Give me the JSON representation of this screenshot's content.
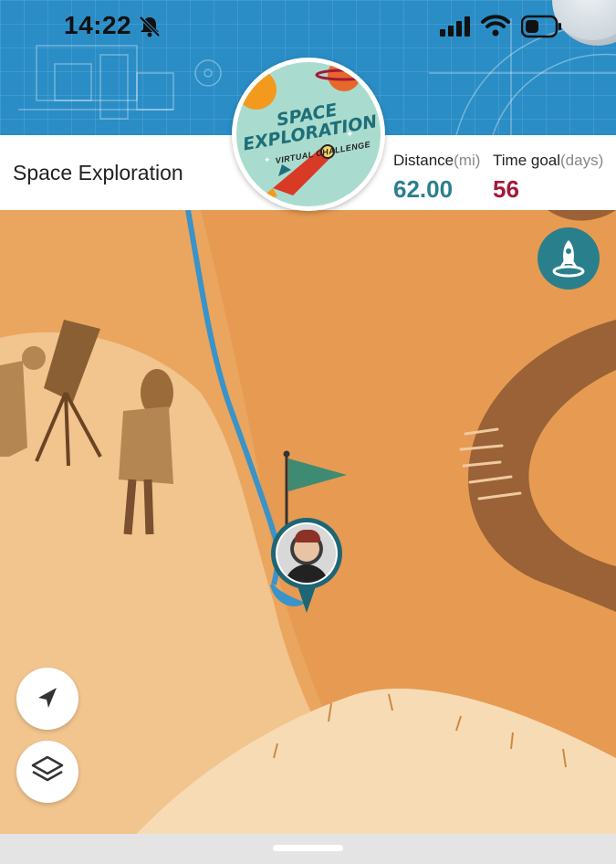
{
  "status_bar": {
    "time": "14:22",
    "icons": [
      "bell-muted-icon",
      "signal-icon",
      "wifi-icon",
      "battery-icon"
    ]
  },
  "header": {
    "title": "Space Exploration",
    "distance": {
      "label": "Distance",
      "unit": "(mi)",
      "value": "62.00"
    },
    "time_goal": {
      "label": "Time goal",
      "unit": "(days)",
      "value": "56"
    }
  },
  "badge": {
    "line1": "SPACE",
    "line2": "EXPLORATION",
    "subtitle": "VIRTUAL CHALLENGE"
  },
  "map": {
    "controls": {
      "rocket_button_icon": "rocket-icon",
      "locate_button_icon": "navigation-arrow-icon",
      "layers_button_icon": "layers-icon"
    },
    "marker": {
      "avatar": "user-avatar"
    }
  },
  "colors": {
    "accent_teal": "#2b7f8e",
    "accent_red": "#a3193a",
    "route_blue": "#3a93c9",
    "blueprint_blue": "#2a8dc6"
  }
}
